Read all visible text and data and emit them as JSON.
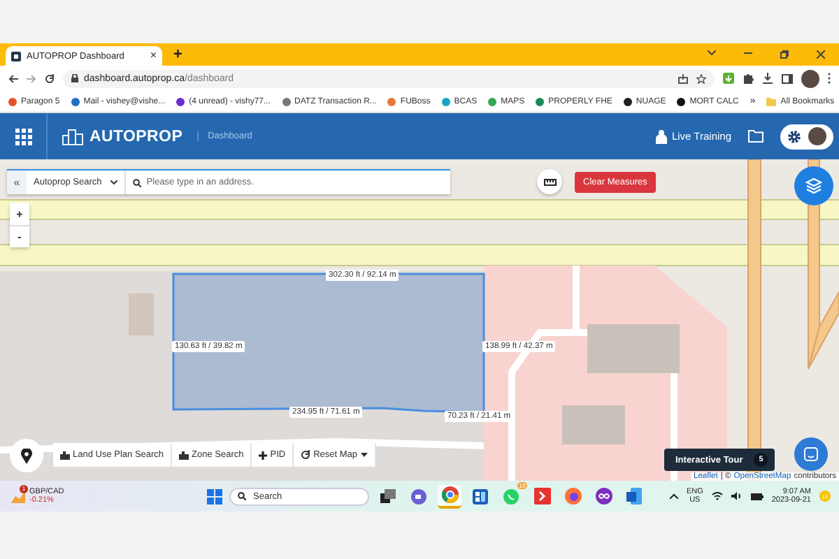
{
  "browser": {
    "tab": {
      "title": "AUTOPROP Dashboard",
      "close": "×"
    },
    "new_tab": "+",
    "url": {
      "host": "dashboard.autoprop.ca",
      "path": "/dashboard"
    },
    "bookmarks": [
      {
        "label": "Paragon 5",
        "color": "#e2532d"
      },
      {
        "label": "Mail - vishey@vishe...",
        "color": "#1f6fc5"
      },
      {
        "label": "(4 unread) - vishy77...",
        "color": "#6b2fd1"
      },
      {
        "label": "DATZ Transaction R...",
        "color": "#777777"
      },
      {
        "label": "FUBoss",
        "color": "#e8773a"
      },
      {
        "label": "BCAS",
        "color": "#1aa3c4"
      },
      {
        "label": "MAPS",
        "color": "#34a853"
      },
      {
        "label": "PROPERLY FHE",
        "color": "#1e8a5a"
      },
      {
        "label": "NUAGE",
        "color": "#222222"
      },
      {
        "label": "MORT CALC",
        "color": "#111111"
      }
    ],
    "more": "»",
    "all_bookmarks": "All Bookmarks"
  },
  "app": {
    "brand": "AUTOPROP",
    "section": "Dashboard",
    "live_training": "Live Training"
  },
  "search": {
    "collapse": "«",
    "source": "Autoprop Search",
    "placeholder": "Please type in an address.",
    "clear_measures": "Clear Measures"
  },
  "zoom": {
    "in": "+",
    "out": "-"
  },
  "measurements": [
    {
      "label": "302.30 ft / 92.14 m"
    },
    {
      "label": "130.63 ft / 39.82 m"
    },
    {
      "label": "138.99 ft / 42.37 m"
    },
    {
      "label": "234.95 ft / 71.61 m"
    },
    {
      "label": "70.23 ft / 21.41 m"
    }
  ],
  "toolbar": [
    {
      "label": "Land Use Plan Search",
      "kind": "building"
    },
    {
      "label": "Zone Search",
      "kind": "building"
    },
    {
      "label": "PID",
      "kind": "plus"
    },
    {
      "label": "Reset Map",
      "kind": "reset"
    }
  ],
  "tour": {
    "label": "Interactive Tour",
    "count": "5"
  },
  "attribution": {
    "leaflet": "Leaflet",
    "separator": "| ©",
    "osm": "OpenStreetMap",
    "rest": "contributors"
  },
  "taskbar": {
    "widget": {
      "badge": "1",
      "title": "GBP/CAD",
      "change": "-0.21%"
    },
    "search_placeholder": "Search",
    "apps": [
      {
        "kind": "taskview",
        "active": false
      },
      {
        "kind": "meet",
        "active": false
      },
      {
        "kind": "browser",
        "active": true
      },
      {
        "kind": "store",
        "active": false
      },
      {
        "kind": "chat",
        "active": false,
        "badge": "18"
      },
      {
        "kind": "remote",
        "active": false
      },
      {
        "kind": "fox",
        "active": false
      },
      {
        "kind": "loop",
        "active": false
      },
      {
        "kind": "doc",
        "active": false
      }
    ],
    "tray": {
      "lang": "ENG",
      "region": "US",
      "time": "9:07 AM",
      "date": "2023-09-21",
      "notifications": "15"
    }
  }
}
